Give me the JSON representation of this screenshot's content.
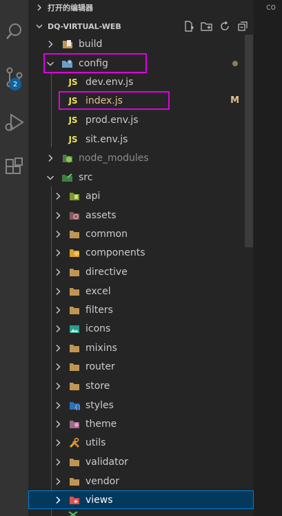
{
  "editor_tab": {
    "label": "co"
  },
  "open_editors": {
    "label": "打开的编辑器"
  },
  "explorer": {
    "root_label": "DQ-VIRTUAL-WEB",
    "actions": [
      "new-file-icon",
      "new-folder-icon",
      "refresh-icon",
      "collapse-all-icon"
    ]
  },
  "badge": {
    "count": "2"
  },
  "tree": {
    "build": "build",
    "config": "config",
    "dev_env": "dev.env.js",
    "index": "index.js",
    "index_status": "M",
    "prod_env": "prod.env.js",
    "sit_env": "sit.env.js",
    "node_modules": "node_modules",
    "src": "src",
    "api": "api",
    "assets": "assets",
    "common": "common",
    "components": "components",
    "directive": "directive",
    "excel": "excel",
    "filters": "filters",
    "icons": "icons",
    "mixins": "mixins",
    "router": "router",
    "store": "store",
    "styles": "styles",
    "theme": "theme",
    "utils": "utils",
    "validator": "validator",
    "vendor": "vendor",
    "views": "views",
    "js_badge": "JS"
  },
  "colors": {
    "selection": "#04395e",
    "highlight_box": "#e000e0",
    "js_icon": "#f1e05a",
    "modified": "#e2c08d",
    "folder": "#c09553"
  }
}
